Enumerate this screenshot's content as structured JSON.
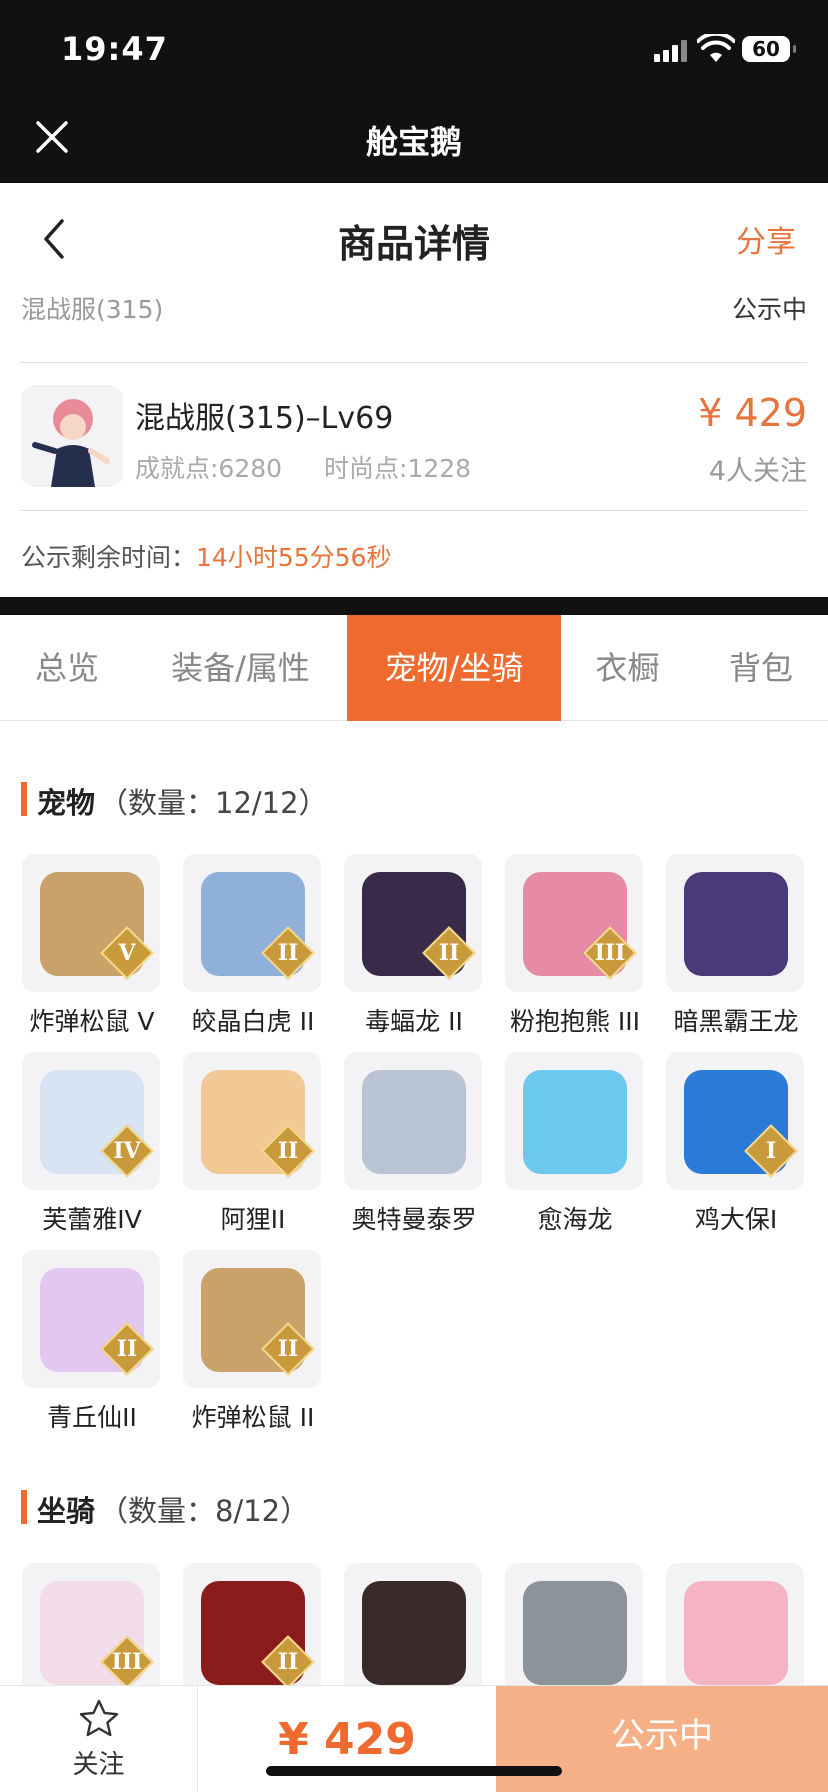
{
  "status_bar": {
    "time": "19:47",
    "battery": "60"
  },
  "app_bar": {
    "title": "舱宝鹅"
  },
  "nav": {
    "title": "商品详情",
    "share": "分享"
  },
  "listing": {
    "server": "混战服(315)",
    "status": "公示中",
    "name": "混战服(315)–Lv69",
    "achievement": "成就点:6280",
    "fashion": "时尚点:1228",
    "price": "¥ 429",
    "followers": "4人关注",
    "remaining_label": "公示剩余时间：",
    "remaining_time": "14小时55分56秒"
  },
  "tabs": [
    {
      "label": "总览",
      "active": false
    },
    {
      "label": "装备/属性",
      "active": false
    },
    {
      "label": "宠物/坐骑",
      "active": true
    },
    {
      "label": "衣橱",
      "active": false
    },
    {
      "label": "背包",
      "active": false
    }
  ],
  "pets": {
    "title": "宠物",
    "count": "（数量：12/12）",
    "items": [
      {
        "name": "炸弹松鼠 V",
        "badge": "V",
        "color": "#c9a26a"
      },
      {
        "name": "皎晶白虎 II",
        "badge": "II",
        "color": "#8fb0d8"
      },
      {
        "name": "毒蝠龙 II",
        "badge": "II",
        "color": "#3a2a4a"
      },
      {
        "name": "粉抱抱熊 III",
        "badge": "III",
        "color": "#e78aa5"
      },
      {
        "name": "暗黑霸王龙",
        "badge": "",
        "color": "#4a3a7a"
      },
      {
        "name": "芙蕾雅IV",
        "badge": "IV",
        "color": "#d8e4f4"
      },
      {
        "name": "阿狸II",
        "badge": "II",
        "color": "#f2c894"
      },
      {
        "name": "奥特曼泰罗",
        "badge": "",
        "color": "#b8c4d4"
      },
      {
        "name": "愈海龙",
        "badge": "",
        "color": "#6cc8ec"
      },
      {
        "name": "鸡大保I",
        "badge": "I",
        "color": "#2a7ad8"
      },
      {
        "name": "青丘仙II",
        "badge": "II",
        "color": "#e2c8f0"
      },
      {
        "name": "炸弹松鼠 II",
        "badge": "II",
        "color": "#c9a26a"
      }
    ]
  },
  "mounts": {
    "title": "坐骑",
    "count": "（数量：8/12）",
    "items": [
      {
        "name": "",
        "badge": "III",
        "color": "#f2dce8"
      },
      {
        "name": "",
        "badge": "II",
        "color": "#8a1c1c"
      },
      {
        "name": "",
        "badge": "",
        "color": "#3a2a2a"
      },
      {
        "name": "",
        "badge": "",
        "color": "#8a949a"
      },
      {
        "name": "",
        "badge": "",
        "color": "#f4b4c4"
      }
    ]
  },
  "bottom_bar": {
    "follow": "关注",
    "price": "¥ 429",
    "action": "公示中"
  },
  "colors": {
    "accent": "#EE6A2F",
    "price": "#E8743B",
    "action_bg": "#F6B088"
  }
}
